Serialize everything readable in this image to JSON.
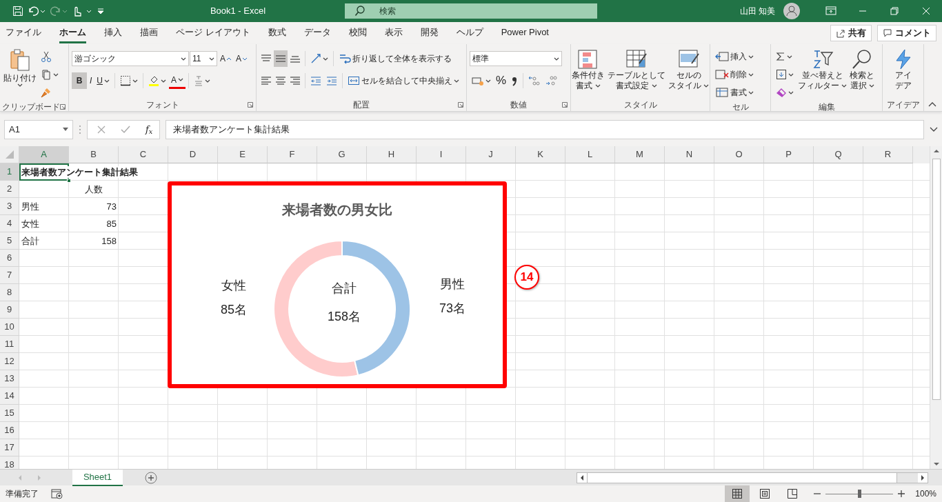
{
  "title_bar": {
    "title": "Book1  -  Excel",
    "search_placeholder": "検索",
    "user_name": "山田 知美"
  },
  "tabs": [
    {
      "label": "ファイル",
      "selected": false
    },
    {
      "label": "ホーム",
      "selected": true
    },
    {
      "label": "挿入",
      "selected": false
    },
    {
      "label": "描画",
      "selected": false
    },
    {
      "label": "ページ レイアウト",
      "selected": false
    },
    {
      "label": "数式",
      "selected": false
    },
    {
      "label": "データ",
      "selected": false
    },
    {
      "label": "校閲",
      "selected": false
    },
    {
      "label": "表示",
      "selected": false
    },
    {
      "label": "開発",
      "selected": false
    },
    {
      "label": "ヘルプ",
      "selected": false
    },
    {
      "label": "Power Pivot",
      "selected": false
    }
  ],
  "share_button": "共有",
  "comment_button": "コメント",
  "ribbon": {
    "clipboard": {
      "label": "クリップボード",
      "paste": "貼り付け"
    },
    "font": {
      "label": "フォント",
      "font_name": "游ゴシック",
      "font_size": "11",
      "grow": "A",
      "shrink": "A",
      "bold": "B",
      "bold_on": true,
      "italic": "I",
      "underline": "U",
      "font_color": "A"
    },
    "alignment": {
      "label": "配置",
      "middle_align_on": true,
      "wrap_text": "折り返して全体を表示する",
      "merge_center": "セルを結合して中央揃え"
    },
    "number": {
      "label": "数値",
      "format": "標準",
      "percent": "%"
    },
    "styles": {
      "label": "スタイル",
      "buttons": [
        [
          "条件付き",
          "書式"
        ],
        [
          "テーブルとして",
          "書式設定"
        ],
        [
          "セルの",
          "スタイル"
        ]
      ]
    },
    "cells": {
      "label": "セル",
      "buttons": [
        "挿入",
        "削除",
        "書式"
      ]
    },
    "editing": {
      "label": "編集",
      "buttons": [
        [
          "並べ替えと",
          "フィルター"
        ],
        [
          "検索と",
          "選択"
        ]
      ]
    },
    "ideas": {
      "label": "アイデア",
      "button": [
        "アイ",
        "デア"
      ]
    }
  },
  "formula_bar": {
    "name_box": "A1",
    "fx": "f$_{x}$",
    "formula": "来場者数アンケート集計結果"
  },
  "sheet": {
    "columns": [
      {
        "label": "A",
        "selected": true
      },
      {
        "label": "B",
        "selected": false
      },
      {
        "label": "C",
        "selected": false
      },
      {
        "label": "D",
        "selected": false
      },
      {
        "label": "E",
        "selected": false
      },
      {
        "label": "F",
        "selected": false
      },
      {
        "label": "G",
        "selected": false
      },
      {
        "label": "H",
        "selected": false
      },
      {
        "label": "I",
        "selected": false
      },
      {
        "label": "J",
        "selected": false
      },
      {
        "label": "K",
        "selected": false
      },
      {
        "label": "L",
        "selected": false
      },
      {
        "label": "M",
        "selected": false
      },
      {
        "label": "N",
        "selected": false
      },
      {
        "label": "O",
        "selected": false
      },
      {
        "label": "P",
        "selected": false
      },
      {
        "label": "Q",
        "selected": false
      },
      {
        "label": "R",
        "selected": false
      }
    ],
    "rows": [
      {
        "label": "1",
        "selected": true,
        "cells": [
          {
            "text": "来場者数アンケート集計結果",
            "kind": "title",
            "active": true
          }
        ]
      },
      {
        "label": "2",
        "selected": false,
        "cells": [
          {
            "kind": "empty",
            "active": false
          },
          {
            "text": "人数",
            "kind": "heading",
            "active": false
          }
        ]
      },
      {
        "label": "3",
        "selected": false,
        "cells": [
          {
            "text": "男性",
            "kind": "text",
            "active": false
          },
          {
            "text": "73",
            "kind": "number",
            "active": false
          }
        ]
      },
      {
        "label": "4",
        "selected": false,
        "cells": [
          {
            "text": "女性",
            "kind": "text",
            "active": false
          },
          {
            "text": "85",
            "kind": "number",
            "active": false
          }
        ]
      },
      {
        "label": "5",
        "selected": false,
        "cells": [
          {
            "text": "合計",
            "kind": "text",
            "active": false
          },
          {
            "text": "158",
            "kind": "number",
            "active": false
          }
        ]
      },
      {
        "label": "6",
        "selected": false
      },
      {
        "label": "7",
        "selected": false
      },
      {
        "label": "8",
        "selected": false
      },
      {
        "label": "9",
        "selected": false
      },
      {
        "label": "10",
        "selected": false
      },
      {
        "label": "11",
        "selected": false
      },
      {
        "label": "12",
        "selected": false
      },
      {
        "label": "13",
        "selected": false
      },
      {
        "label": "14",
        "selected": false
      },
      {
        "label": "15",
        "selected": false
      },
      {
        "label": "16",
        "selected": false
      },
      {
        "label": "17",
        "selected": false
      },
      {
        "label": "18",
        "selected": false
      }
    ]
  },
  "chart": {
    "chart_data": {
      "type": "donut",
      "title": "来場者数の男女比",
      "categories": [
        "女性",
        "男性"
      ],
      "values": [
        85,
        73
      ],
      "value_labels": [
        "85名",
        "73名"
      ]
    },
    "slices": [
      {
        "color": "#ffcccc"
      },
      {
        "color": "#9dc3e6"
      }
    ],
    "center_label": {
      "name": "合計",
      "count": "158名"
    }
  },
  "callout": "14",
  "sheet_tabs": [
    {
      "label": "Sheet1",
      "selected": true
    }
  ],
  "status_bar": {
    "text": "準備完了",
    "views": [
      {
        "kind": "normal",
        "selected": true
      },
      {
        "kind": "page_layout",
        "selected": false
      },
      {
        "kind": "page_break",
        "selected": false
      }
    ],
    "zoom": {
      "level": 0.5,
      "text": "100%"
    }
  }
}
